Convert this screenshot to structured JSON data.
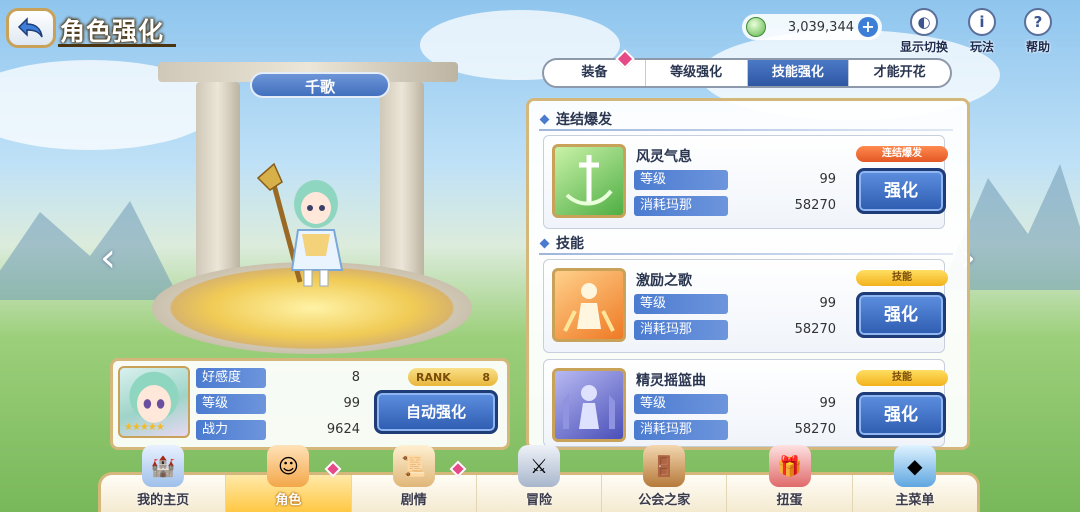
{
  "header": {
    "title": "角色强化",
    "currency": "3,039,344",
    "tools": [
      {
        "label": "显示切换",
        "icon": "display-switch-icon"
      },
      {
        "label": "玩法",
        "icon": "info-icon"
      },
      {
        "label": "帮助",
        "icon": "help-icon"
      }
    ]
  },
  "tabs": [
    "装备",
    "等级强化",
    "技能强化",
    "才能开花"
  ],
  "active_tab": "技能强化",
  "character": {
    "name": "千歌",
    "stats": [
      {
        "label": "好感度",
        "value": "8"
      },
      {
        "label": "等级",
        "value": "99"
      },
      {
        "label": "战力",
        "value": "9624"
      }
    ],
    "rank_label": "RANK",
    "rank_value": "8",
    "auto_button": "自动强化"
  },
  "sections": {
    "union_burst": "连结爆发",
    "skills": "技能"
  },
  "skills": [
    {
      "name": "风灵气息",
      "tag": "连结爆发",
      "level_label": "等级",
      "level": "99",
      "cost_label": "消耗玛那",
      "cost": "58270",
      "button": "强化",
      "icon_color": "#5fbf55"
    },
    {
      "name": "激励之歌",
      "tag": "技能",
      "level_label": "等级",
      "level": "99",
      "cost_label": "消耗玛那",
      "cost": "58270",
      "button": "强化",
      "icon_color": "#f08a2c"
    },
    {
      "name": "精灵摇篮曲",
      "tag": "技能",
      "level_label": "等级",
      "level": "99",
      "cost_label": "消耗玛那",
      "cost": "58270",
      "button": "强化",
      "icon_color": "#5a5fc4"
    }
  ],
  "bottom_nav": [
    {
      "label": "我的主页",
      "icon": "castle-icon"
    },
    {
      "label": "角色",
      "icon": "character-icon"
    },
    {
      "label": "剧情",
      "icon": "scroll-icon"
    },
    {
      "label": "冒险",
      "icon": "sword-icon"
    },
    {
      "label": "公会之家",
      "icon": "guild-door-icon"
    },
    {
      "label": "扭蛋",
      "icon": "gacha-icon"
    },
    {
      "label": "主菜单",
      "icon": "crystal-icon"
    }
  ],
  "active_nav": "角色"
}
